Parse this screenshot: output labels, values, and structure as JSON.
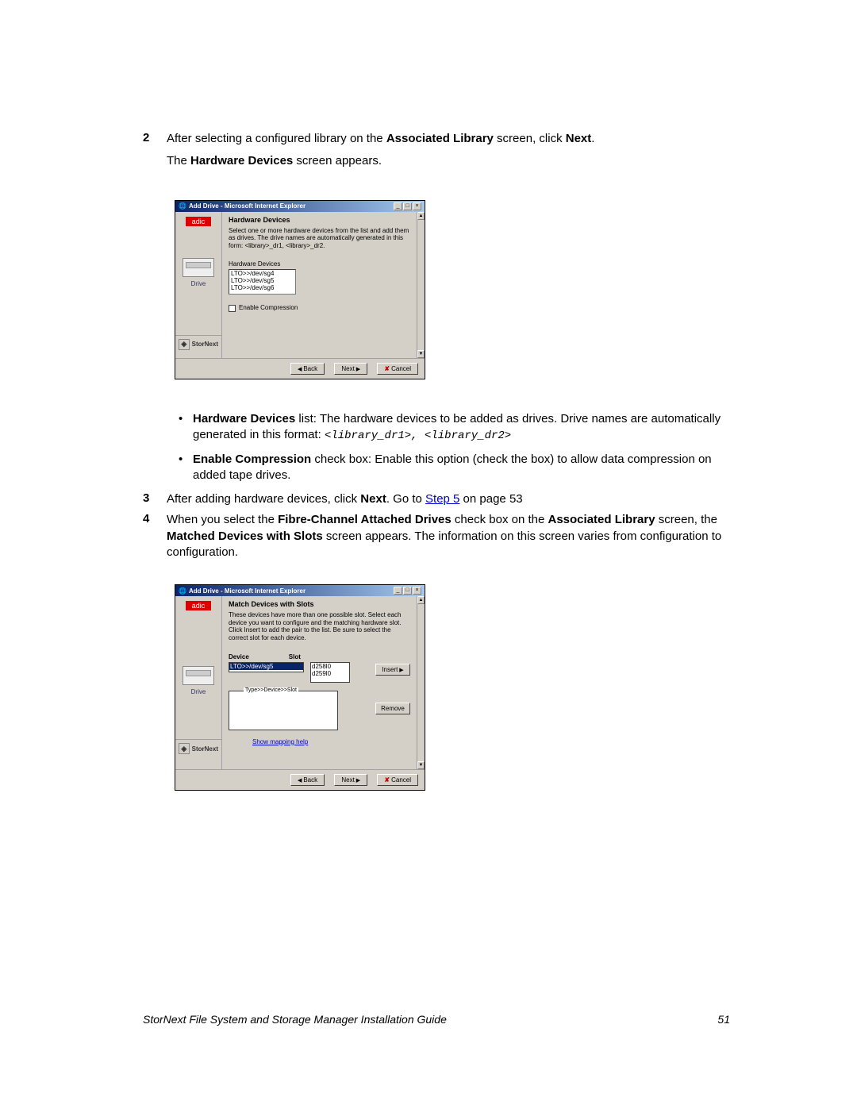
{
  "step2": {
    "num": "2",
    "text_a": "After selecting a configured library on the ",
    "b1": "Associated Library",
    "text_b": " screen, click ",
    "b2": "Next",
    "text_c": ".",
    "line2_a": "The ",
    "line2_b": "Hardware Devices",
    "line2_c": " screen appears."
  },
  "shot1": {
    "window_title": "Add Drive - Microsoft Internet Explorer",
    "panel_title": "Hardware Devices",
    "desc": "Select one or more hardware devices from the list and add them as drives. The drive names are automatically generated in this form: <library>_dr1, <library>_dr2.",
    "list_label": "Hardware Devices",
    "items": [
      "LTO>>/dev/sg4",
      "LTO>>/dev/sg5",
      "LTO>>/dev/sg6"
    ],
    "checkbox": "Enable Compression",
    "sidebar_label": "Drive",
    "brand": "adic",
    "stornext": "StorNext",
    "back": "Back",
    "next": "Next",
    "cancel": "Cancel"
  },
  "bullets": {
    "hd_b": "Hardware Devices",
    "hd_text": " list: The hardware devices to be added as drives. Drive names are automatically generated in this format: ",
    "hd_code": "<library_dr1>, <library_dr2>",
    "ec_b": "Enable Compression",
    "ec_text": " check box: Enable this option (check the box) to allow data compression on added tape drives."
  },
  "step3": {
    "num": "3",
    "text_a": "After adding hardware devices, click ",
    "b1": "Next",
    "text_b": ". Go to ",
    "link": "Step 5",
    "text_c": " on page 53"
  },
  "step4": {
    "num": "4",
    "text_a": "When you select the ",
    "b1": "Fibre-Channel Attached Drives",
    "text_b": " check box on the ",
    "b2": "Associated Library",
    "text_c": " screen, the ",
    "b3": "Matched Devices with Slots",
    "text_d": " screen appears. The information on this screen varies from configuration to configuration."
  },
  "shot2": {
    "window_title": "Add Drive - Microsoft Internet Explorer",
    "panel_title": "Match Devices with Slots",
    "desc": "These devices have more than one possible slot. Select each device you want to configure and the matching hardware slot. Click Insert to add the pair to the list. Be sure to select the correct slot for each device.",
    "device_h": "Device",
    "slot_h": "Slot",
    "device_items": [
      "LTO>>/dev/sg5"
    ],
    "slot_items": [
      "d258l0",
      "d259l0"
    ],
    "insert": "Insert",
    "remove": "Remove",
    "pairbox": "Type>>Device>>Slot",
    "maplink": "Show mapping help",
    "sidebar_label": "Drive",
    "brand": "adic",
    "stornext": "StorNext",
    "back": "Back",
    "next": "Next",
    "cancel": "Cancel"
  },
  "footer": {
    "title": "StorNext File System and Storage Manager Installation Guide",
    "page": "51"
  }
}
